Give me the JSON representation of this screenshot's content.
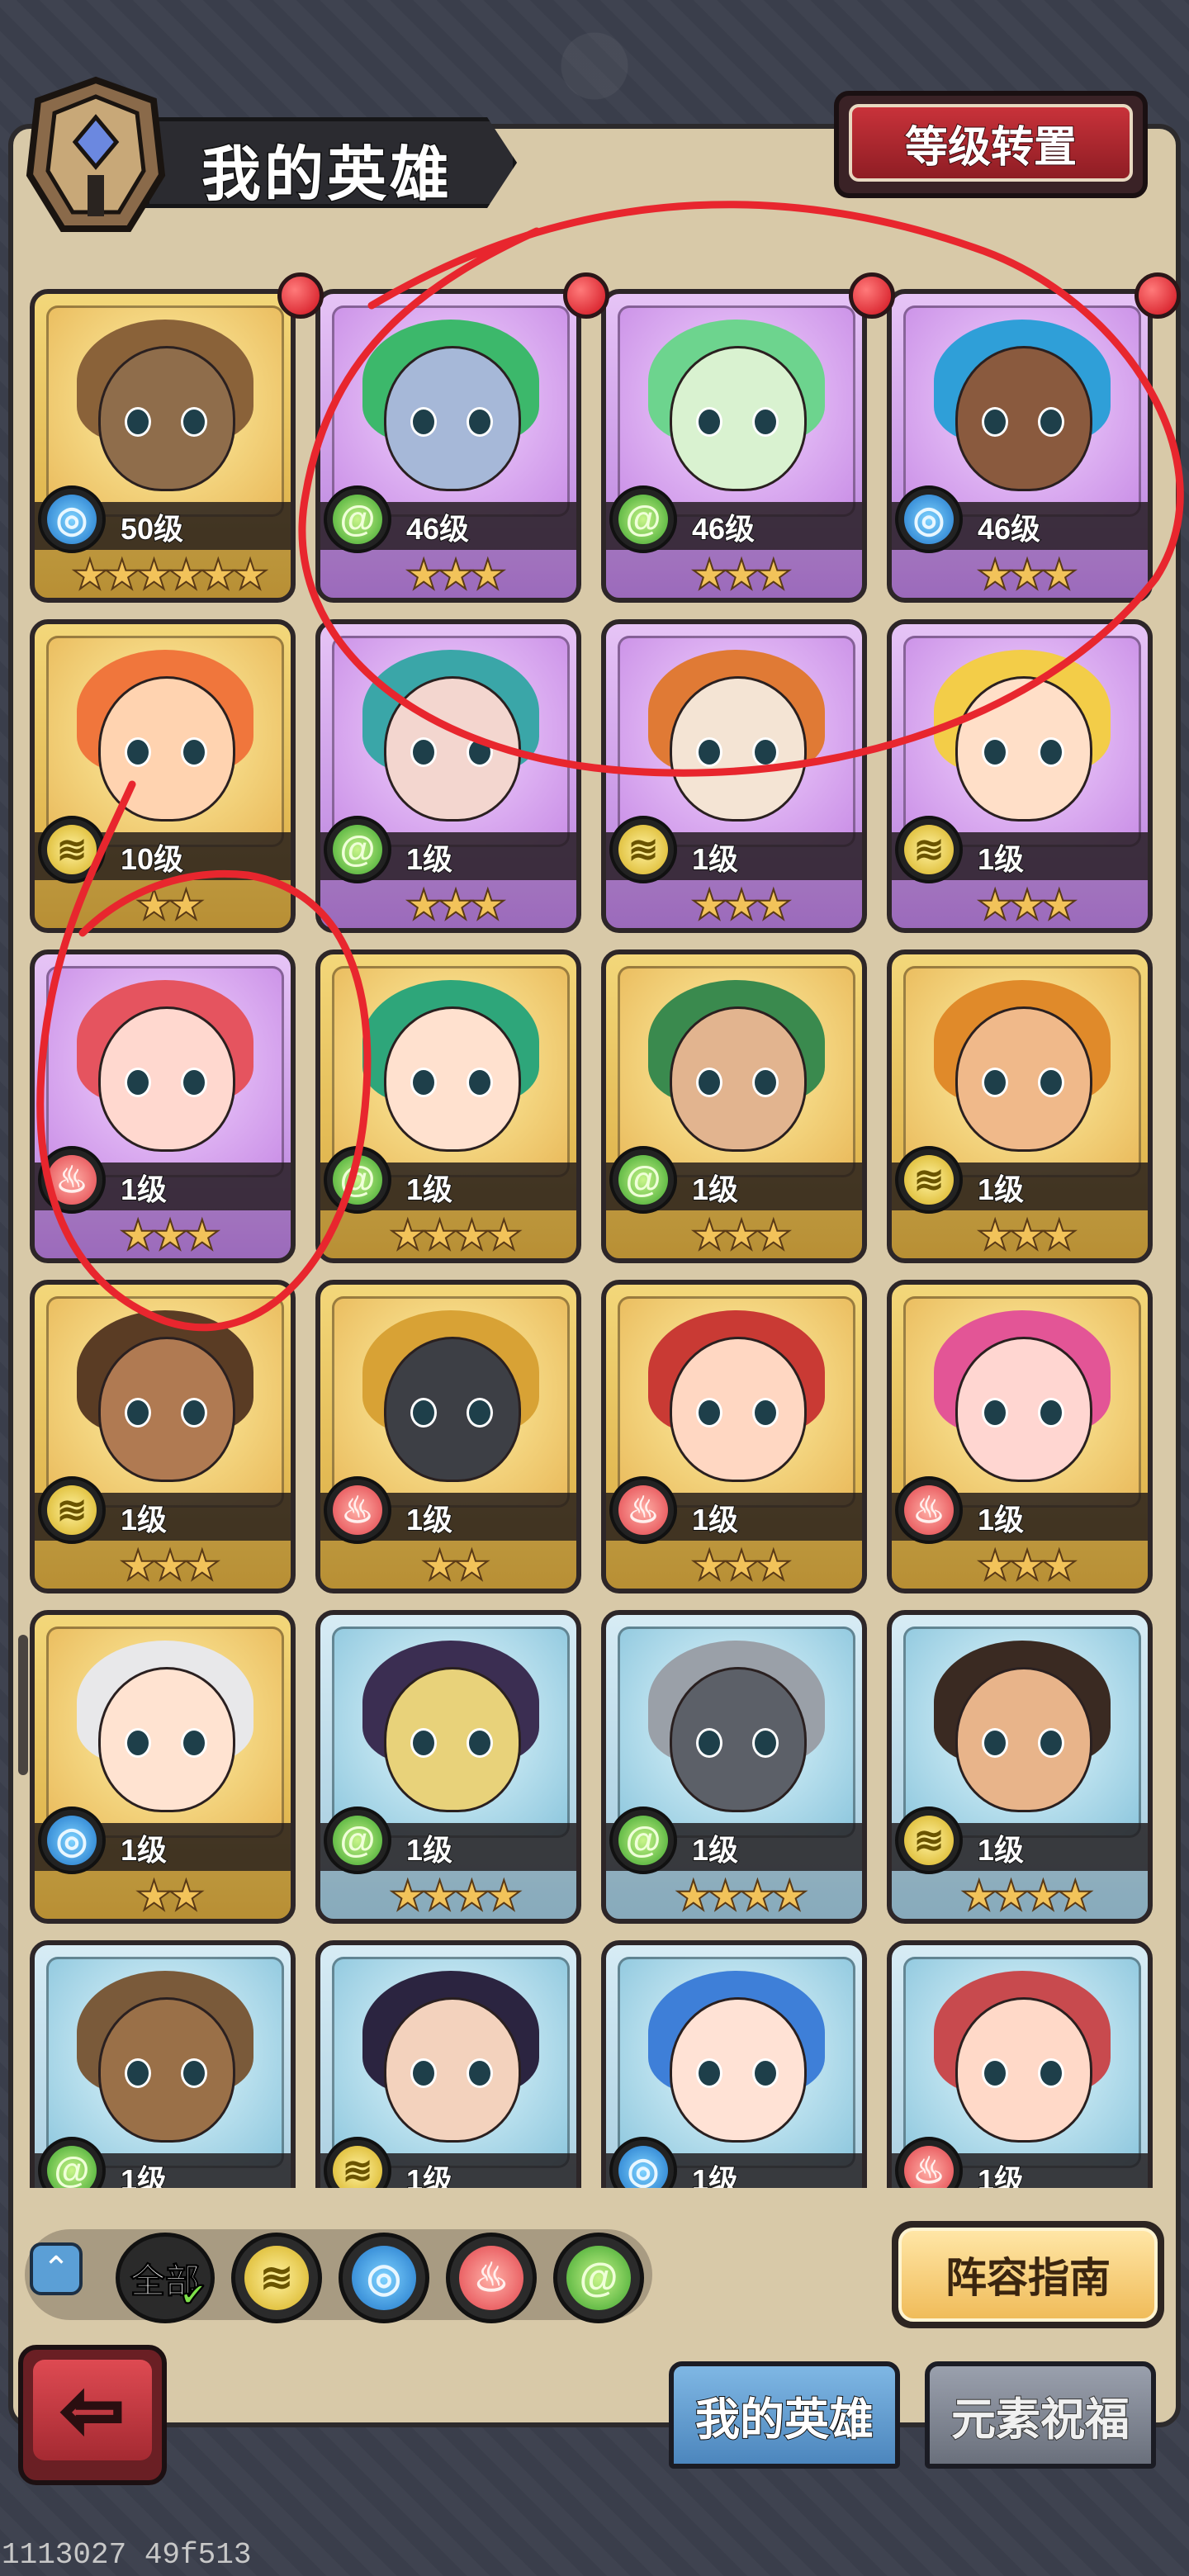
{
  "header": {
    "title": "我的英雄",
    "reset_button": "等级转置"
  },
  "heroes": [
    {
      "level": "50级",
      "stars": "★★★★★★",
      "element": "water",
      "frame": "gold",
      "new": true,
      "hair": "#8a6239",
      "skin": "#8f6d4b"
    },
    {
      "level": "46级",
      "stars": "★★★",
      "element": "wind",
      "frame": "purple",
      "new": true,
      "hair": "#3cb86b",
      "skin": "#a6b8d8"
    },
    {
      "level": "46级",
      "stars": "★★★",
      "element": "wind",
      "frame": "purple",
      "new": true,
      "hair": "#6dd48e",
      "skin": "#d9f2d0"
    },
    {
      "level": "46级",
      "stars": "★★★",
      "element": "water",
      "frame": "purple",
      "new": true,
      "hair": "#2f9fd8",
      "skin": "#8a5a3e"
    },
    {
      "level": "10级",
      "stars": "★★",
      "element": "earth",
      "frame": "gold",
      "new": false,
      "hair": "#f0763c",
      "skin": "#ffd3b0"
    },
    {
      "level": "1级",
      "stars": "★★★",
      "element": "wind",
      "frame": "purple",
      "new": false,
      "hair": "#3aa6a8",
      "skin": "#f3d6cf"
    },
    {
      "level": "1级",
      "stars": "★★★",
      "element": "earth",
      "frame": "purple",
      "new": false,
      "hair": "#e07a35",
      "skin": "#f4e4d4"
    },
    {
      "level": "1级",
      "stars": "★★★",
      "element": "earth",
      "frame": "purple",
      "new": false,
      "hair": "#f3cd48",
      "skin": "#ffdfc8"
    },
    {
      "level": "1级",
      "stars": "★★★",
      "element": "fire",
      "frame": "purple",
      "new": false,
      "hair": "#e5545f",
      "skin": "#ffd8cf"
    },
    {
      "level": "1级",
      "stars": "★★★★",
      "element": "wind",
      "frame": "gold",
      "new": false,
      "hair": "#2ea67a",
      "skin": "#ffe1cf"
    },
    {
      "level": "1级",
      "stars": "★★★",
      "element": "wind",
      "frame": "gold",
      "new": false,
      "hair": "#3a8a4e",
      "skin": "#e2b48f"
    },
    {
      "level": "1级",
      "stars": "★★★",
      "element": "earth",
      "frame": "gold",
      "new": false,
      "hair": "#e08a2a",
      "skin": "#f0b98a"
    },
    {
      "level": "1级",
      "stars": "★★★",
      "element": "earth",
      "frame": "gold",
      "new": false,
      "hair": "#5a3c24",
      "skin": "#b07a52"
    },
    {
      "level": "1级",
      "stars": "★★",
      "element": "fire",
      "frame": "gold",
      "new": false,
      "hair": "#d8a235",
      "skin": "#3d3f45"
    },
    {
      "level": "1级",
      "stars": "★★★",
      "element": "fire",
      "frame": "gold",
      "new": false,
      "hair": "#c93a34",
      "skin": "#ffd7c2"
    },
    {
      "level": "1级",
      "stars": "★★★",
      "element": "fire",
      "frame": "gold",
      "new": false,
      "hair": "#e35596",
      "skin": "#ffd6d1"
    },
    {
      "level": "1级",
      "stars": "★★",
      "element": "water",
      "frame": "gold",
      "new": false,
      "hair": "#e8e8ea",
      "skin": "#ffe3d1"
    },
    {
      "level": "1级",
      "stars": "★★★★",
      "element": "wind",
      "frame": "blue",
      "new": false,
      "hair": "#3b2e52",
      "skin": "#e8d27a"
    },
    {
      "level": "1级",
      "stars": "★★★★",
      "element": "wind",
      "frame": "blue",
      "new": false,
      "hair": "#9aa0a8",
      "skin": "#5c6068"
    },
    {
      "level": "1级",
      "stars": "★★★★",
      "element": "earth",
      "frame": "blue",
      "new": false,
      "hair": "#3a2a22",
      "skin": "#e8b48a"
    },
    {
      "level": "1级",
      "stars": "★★★",
      "element": "wind",
      "frame": "blue",
      "new": false,
      "hair": "#7a5a3a",
      "skin": "#9a7048"
    },
    {
      "level": "1级",
      "stars": "★★★",
      "element": "earth",
      "frame": "blue",
      "new": false,
      "hair": "#2b2440",
      "skin": "#f3d2bd"
    },
    {
      "level": "1级",
      "stars": "★★★",
      "element": "water",
      "frame": "blue",
      "new": false,
      "hair": "#3e7fd8",
      "skin": "#ffe2d5"
    },
    {
      "level": "1级",
      "stars": "★★★",
      "element": "fire",
      "frame": "blue",
      "new": false,
      "hair": "#c84a4e",
      "skin": "#ffd9c8"
    }
  ],
  "element_glyphs": {
    "water": "◎",
    "wind": "@",
    "earth": "≋",
    "fire": "♨"
  },
  "filters": {
    "all_label": "全部",
    "elements": [
      "earth",
      "water",
      "fire",
      "wind"
    ]
  },
  "guide_button": "阵容指南",
  "tabs": {
    "my_heroes": "我的英雄",
    "element_blessing": "元素祝福"
  },
  "build_id": "1113027 49f513",
  "colors": {
    "panel": "#d8c9a8",
    "annotation_red": "#e8262e",
    "reset_red": "#c8323a",
    "tab_active": "#4c86bd"
  }
}
